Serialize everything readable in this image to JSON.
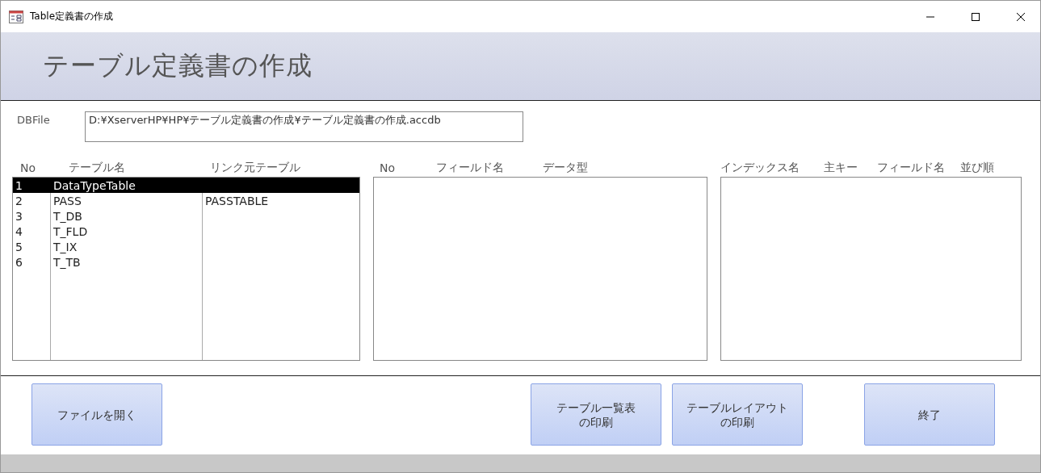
{
  "window": {
    "title": "Table定義書の作成"
  },
  "header": {
    "title": "テーブル定義書の作成"
  },
  "db_file": {
    "label": "DBFile",
    "value": "D:¥XserverHP¥HP¥テーブル定義書の作成¥テーブル定義書の作成.accdb"
  },
  "table_list": {
    "columns": [
      "No",
      "テーブル名",
      "リンク元テーブル"
    ],
    "rows": [
      {
        "cells": [
          "1",
          "DataTypeTable",
          ""
        ],
        "selected": true
      },
      {
        "cells": [
          "2",
          "PASS",
          "PASSTABLE"
        ],
        "selected": false
      },
      {
        "cells": [
          "3",
          "T_DB",
          ""
        ],
        "selected": false
      },
      {
        "cells": [
          "4",
          "T_FLD",
          ""
        ],
        "selected": false
      },
      {
        "cells": [
          "5",
          "T_IX",
          ""
        ],
        "selected": false
      },
      {
        "cells": [
          "6",
          "T_TB",
          ""
        ],
        "selected": false
      }
    ]
  },
  "field_list": {
    "columns": [
      "No",
      "フィールド名",
      "データ型"
    ]
  },
  "index_list": {
    "columns": [
      "インデックス名",
      "主キー",
      "フィールド名",
      "並び順"
    ]
  },
  "buttons": [
    {
      "lines": [
        "ファイルを開く"
      ]
    },
    {
      "lines": [
        "テーブル一覧表",
        "の印刷"
      ]
    },
    {
      "lines": [
        "テーブルレイアウト",
        "の印刷"
      ]
    },
    {
      "lines": [
        "終了"
      ]
    }
  ]
}
